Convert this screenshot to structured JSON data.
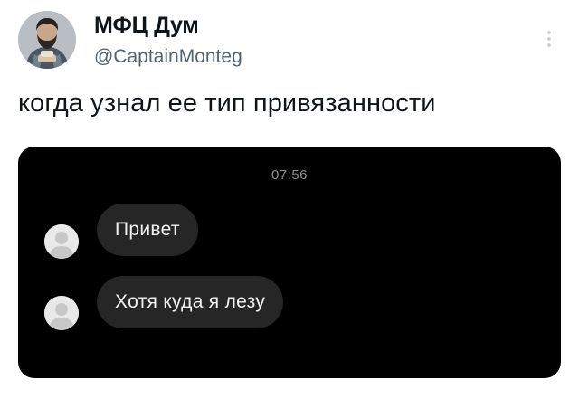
{
  "author": {
    "display_name": "МФЦ Дум",
    "handle": "@CaptainMonteg"
  },
  "tweet": {
    "text": "когда узнал ее тип привязанности"
  },
  "media": {
    "chat": {
      "timestamp": "07:56",
      "messages": [
        {
          "text": "Привет"
        },
        {
          "text": "Хотя куда я лезу"
        }
      ]
    }
  },
  "icons": {
    "more": "more-vertical-icon",
    "default_avatar": "default-avatar-icon"
  },
  "colors": {
    "text_primary": "#0f1419",
    "text_secondary": "#536471",
    "media_background": "#000000",
    "bubble": "#262626"
  }
}
